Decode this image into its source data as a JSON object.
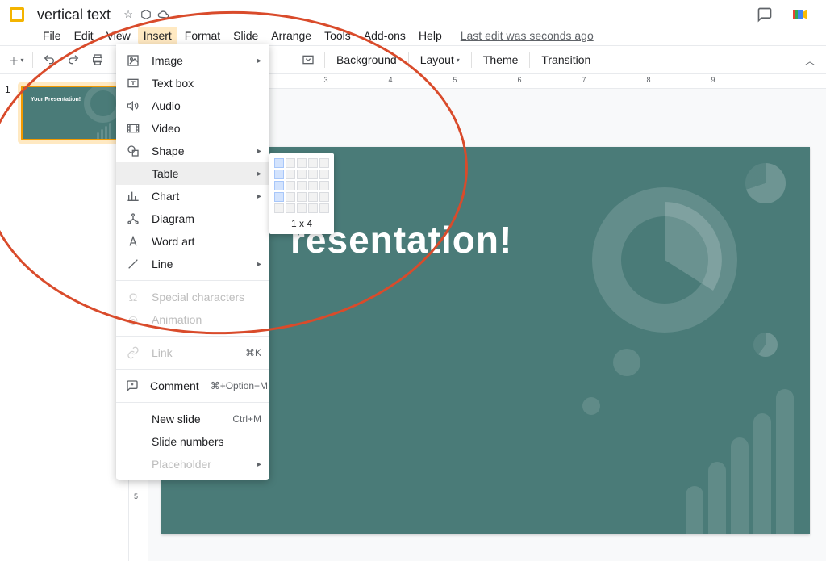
{
  "doc": {
    "title": "vertical text"
  },
  "menubar": {
    "items": [
      "File",
      "Edit",
      "View",
      "Insert",
      "Format",
      "Slide",
      "Arrange",
      "Tools",
      "Add-ons",
      "Help"
    ],
    "active": "Insert",
    "last_edit": "Last edit was seconds ago"
  },
  "toolbar": {
    "background": "Background",
    "layout": "Layout",
    "theme": "Theme",
    "transition": "Transition"
  },
  "insert_menu": {
    "image": "Image",
    "textbox": "Text box",
    "audio": "Audio",
    "video": "Video",
    "shape": "Shape",
    "table": "Table",
    "chart": "Chart",
    "diagram": "Diagram",
    "wordart": "Word art",
    "line": "Line",
    "special": "Special characters",
    "animation": "Animation",
    "link": "Link",
    "link_sc": "⌘K",
    "comment": "Comment",
    "comment_sc": "⌘+Option+M",
    "newslide": "New slide",
    "newslide_sc": "Ctrl+M",
    "slidenumbers": "Slide numbers",
    "placeholder": "Placeholder"
  },
  "table_picker": {
    "size": "1 x 4"
  },
  "slide": {
    "number": "1",
    "title_full": "Your Presentation!",
    "title_visible": "resentation!",
    "thumb_title": "Your Presentation!"
  },
  "ruler": {
    "h": [
      "3",
      "4",
      "5",
      "6",
      "7",
      "8",
      "9"
    ]
  }
}
